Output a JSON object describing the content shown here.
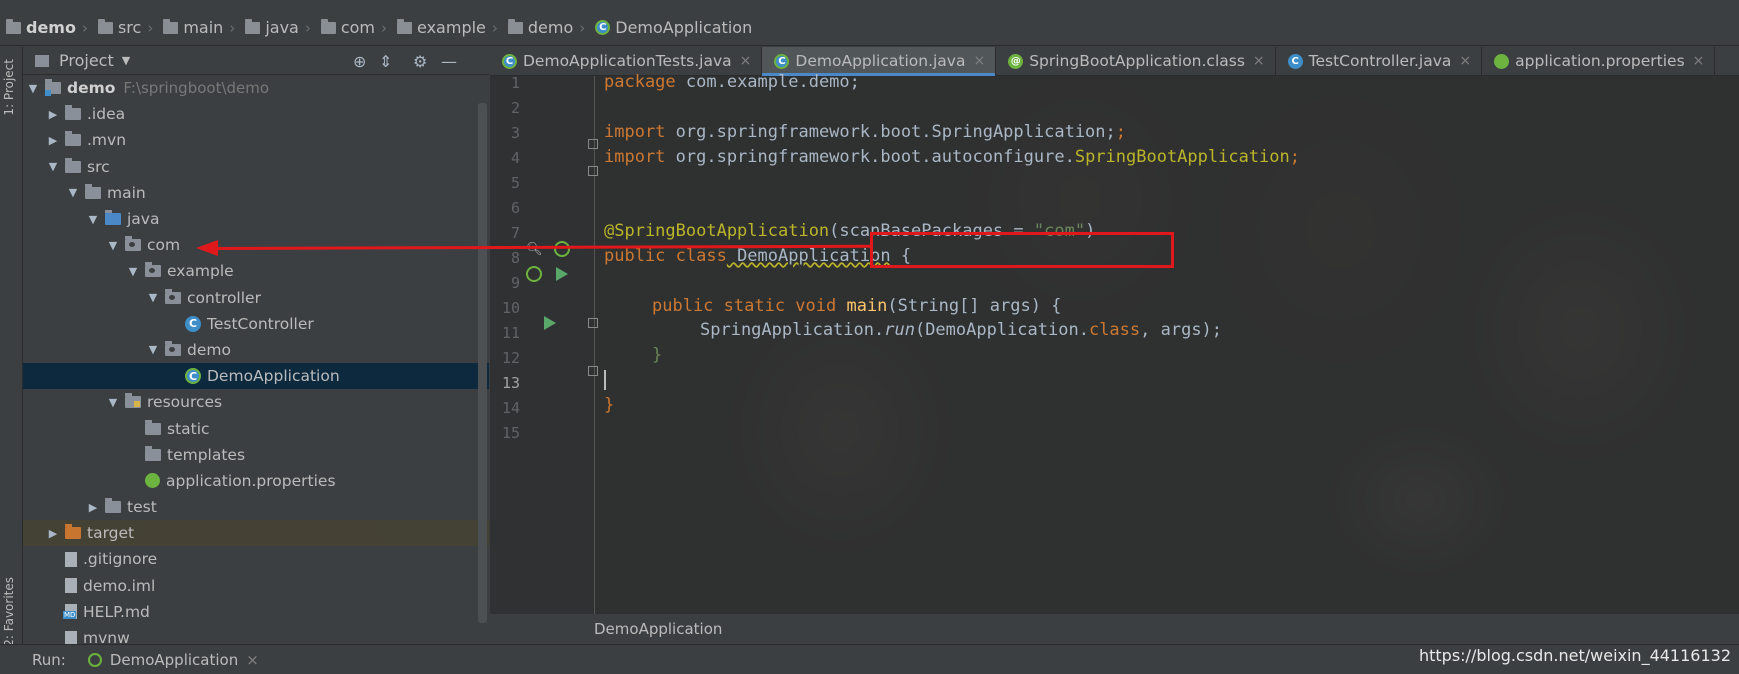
{
  "navbar": {
    "crumbs": [
      "demo",
      "src",
      "main",
      "java",
      "com",
      "example",
      "demo",
      "DemoApplication"
    ]
  },
  "left_strip": {
    "project_tab": "1: Project",
    "favorites_tab": "2: Favorites"
  },
  "project_panel": {
    "title": "Project",
    "root": {
      "name": "demo",
      "path": "F:\\springboot\\demo"
    },
    "items": [
      ".idea",
      ".mvn",
      "src",
      "main",
      "java",
      "com",
      "example",
      "controller",
      "TestController",
      "demo",
      "DemoApplication",
      "resources",
      "static",
      "templates",
      "application.properties",
      "test",
      "target",
      ".gitignore",
      "demo.iml",
      "HELP.md",
      "mvnw"
    ]
  },
  "tabs": [
    "DemoApplicationTests.java",
    "DemoApplication.java",
    "SpringBootApplication.class",
    "TestController.java",
    "application.properties"
  ],
  "editor": {
    "line_numbers": [
      "1",
      "2",
      "3",
      "4",
      "5",
      "6",
      "7",
      "8",
      "9",
      "10",
      "11",
      "12",
      "13",
      "14",
      "15"
    ],
    "code": {
      "l1_kw": "package",
      "l1_rest": " com.example.demo;",
      "l3_kw": "import",
      "l3_rest": " org.springframework.boot.SpringApplication;",
      "l4_kw": "import",
      "l4_rest": " org.springframework.boot.autoconfigure.",
      "l4_cls": "SpringBootApplication",
      "l4_end": ";",
      "l7_ann": "@SpringBootApplication",
      "l7_open": "(scanBasePackages = ",
      "l7_str": "\"com\"",
      "l7_close": ")",
      "l8_kw": "public class",
      "l8_name": " DemoApplication",
      "l8_end": " {",
      "l10_kw": "public static void",
      "l10_fn": " main",
      "l10_rest": "(String[] args) {",
      "l11_a": "SpringApplication.",
      "l11_run": "run",
      "l11_b": "(DemoApplication.",
      "l11_kw": "class",
      "l11_c": ", args);",
      "l12": "}",
      "l14": "}"
    },
    "bottom_breadcrumb": "DemoApplication"
  },
  "run_bar": {
    "label": "Run:",
    "config": "DemoApplication"
  },
  "watermark": "https://blog.csdn.net/weixin_44116132",
  "colors": {
    "highlight": "#e0181b",
    "keyword": "#cc7832",
    "annotation": "#bbb529",
    "string": "#6a8759"
  }
}
